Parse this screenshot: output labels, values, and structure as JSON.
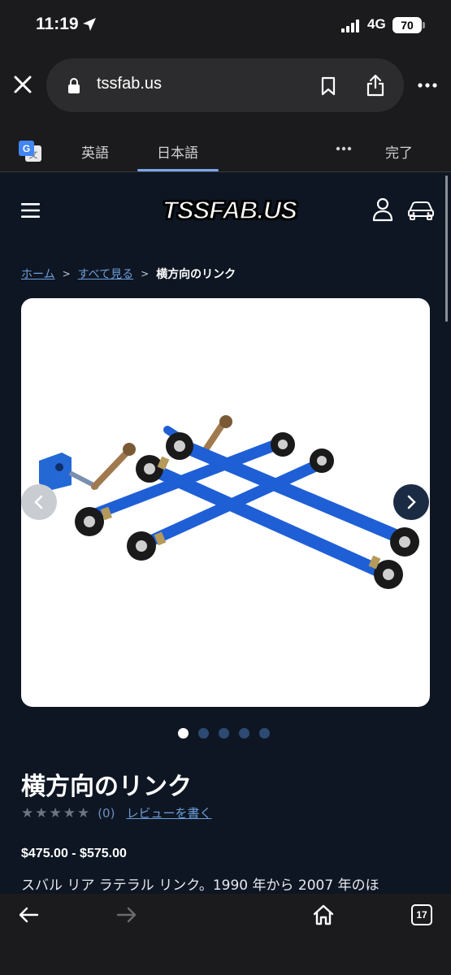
{
  "status_bar": {
    "time": "11:19",
    "network": "4G",
    "battery": "70"
  },
  "browser": {
    "url": "tssfab.us",
    "translate": {
      "source_lang": "英語",
      "target_lang": "日本語",
      "done_label": "完了"
    },
    "tab_count": "17"
  },
  "site": {
    "logo": "TSSFAB.US",
    "breadcrumb": {
      "home": "ホーム",
      "sep": ">",
      "all": "すべて見る",
      "current": "横方向のリンク"
    },
    "product": {
      "title": "横方向のリンク",
      "stars": "★★★★★",
      "review_count": "(0)",
      "write_review": "レビューを書く",
      "price": "$475.00 - $575.00",
      "description": "スバル リア ラテラル リンク。1990 年から 2007 年のほ"
    },
    "gallery": {
      "image_count": 5,
      "active_index": 0
    }
  },
  "colors": {
    "page_bg": "#0e1623",
    "chrome_bg": "#1b1b1d",
    "link": "#6e9fd8",
    "arm_blue": "#1f5fd6"
  }
}
